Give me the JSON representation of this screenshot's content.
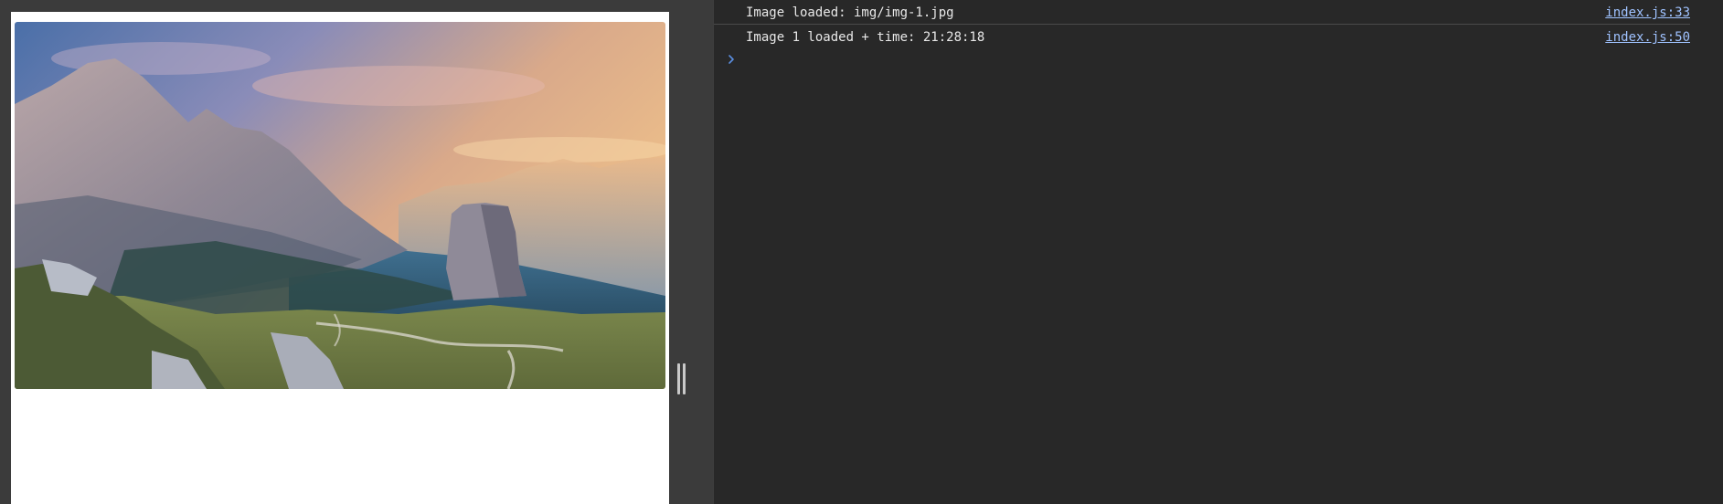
{
  "console": {
    "logs": [
      {
        "message": "Image loaded: img/img-1.jpg",
        "source": "index.js:33"
      },
      {
        "message": "Image 1 loaded + time: 21:28:18",
        "source": "index.js:50"
      }
    ],
    "prompt_icon": "chevron-right-icon"
  },
  "viewport": {
    "image_subject": "mountain-landscape-photo"
  },
  "colors": {
    "console_bg": "#282828",
    "link": "#9fc2ff",
    "prompt": "#5a8ee0"
  }
}
